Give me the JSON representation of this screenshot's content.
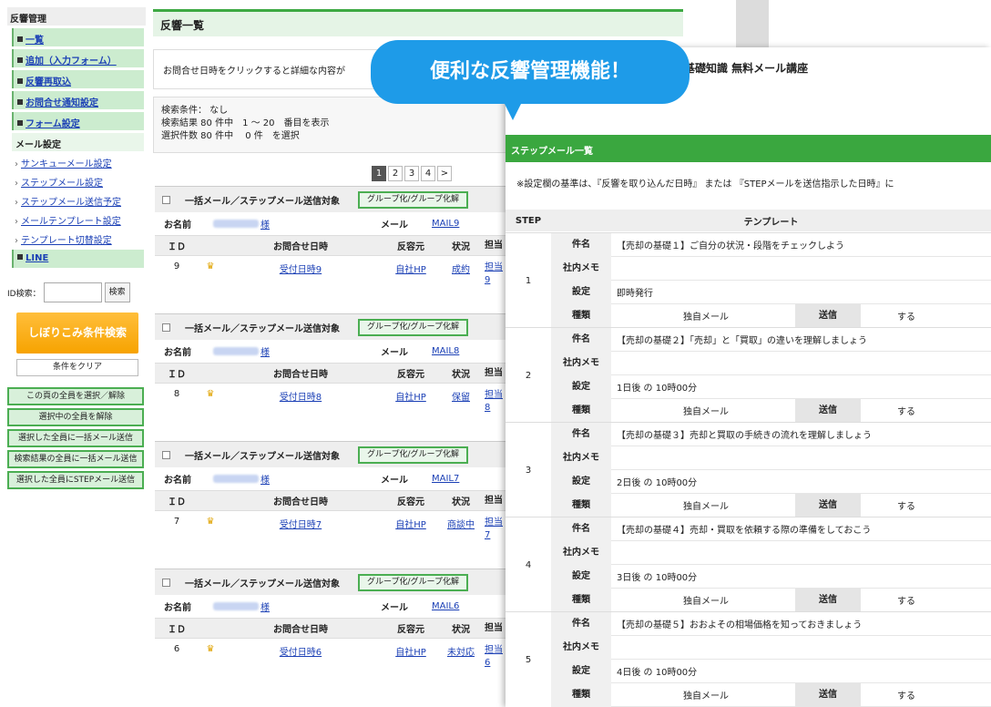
{
  "sidebar": {
    "title": "反響管理",
    "items": [
      {
        "label": "一覧"
      },
      {
        "label": "追加（入力フォーム）"
      },
      {
        "label": "反響再取込"
      },
      {
        "label": "お問合せ通知設定"
      },
      {
        "label": "フォーム設定"
      }
    ],
    "mail_section": "メール設定",
    "mail_links": [
      {
        "label": "サンキューメール設定"
      },
      {
        "label": "ステップメール設定"
      },
      {
        "label": "ステップメール送信予定"
      },
      {
        "label": "メールテンプレート設定"
      },
      {
        "label": "テンプレート切替設定"
      }
    ],
    "line_item": "LINE",
    "id_search_label": "ID検索：",
    "id_search_button": "検索",
    "filter_button": "しぼりこみ条件検索",
    "clear_button": "条件をクリア",
    "bulk_buttons": [
      "この頁の全員を選択／解除",
      "選択中の全員を解除",
      "選択した全員に一括メール送信",
      "検索結果の全員に一括メール送信",
      "選択した全員にSTEPメール送信"
    ]
  },
  "main": {
    "title": "反響一覧",
    "notice": "お問合せ日時をクリックすると詳細な内容が",
    "conditions": [
      "検索条件： なし",
      "検索結果 80 件中　1 ～ 20　番目を表示",
      "選択件数 80 件中　 0 件　を選択"
    ],
    "pages": [
      "1",
      "2",
      "3",
      "4",
      ">"
    ],
    "card_header": "一括メール／ステップメール送信対象",
    "group_button": "グループ化/グループ化解",
    "name_label": "お名前",
    "name_suffix": "様",
    "mail_label": "メール",
    "columns": {
      "id": "ＩＤ",
      "date": "お問合せ日時",
      "source": "反容元",
      "status": "状況",
      "staff": "担当"
    },
    "crown": "♛",
    "records": [
      {
        "mail": "MAIL9",
        "id": "9",
        "date": "受付日時9",
        "source": "自社HP",
        "status": "成約",
        "staff1": "担当",
        "staff2": "9"
      },
      {
        "mail": "MAIL8",
        "id": "8",
        "date": "受付日時8",
        "source": "自社HP",
        "status": "保留",
        "staff1": "担当",
        "staff2": "8"
      },
      {
        "mail": "MAIL7",
        "id": "7",
        "date": "受付日時7",
        "source": "自社HP",
        "status": "商談中",
        "staff1": "担当",
        "staff2": "7"
      },
      {
        "mail": "MAIL6",
        "id": "6",
        "date": "受付日時6",
        "source": "自社HP",
        "status": "未対応",
        "staff1": "担当",
        "staff2": "6"
      }
    ]
  },
  "overlay": {
    "course_title": "売却の基礎知識 無料メール講座",
    "section_title": "ステップメール一覧",
    "note": "※設定欄の基準は、『反響を取り込んだ日時』 または 『STEPメールを送信指示した日時』に",
    "col_step": "STEP",
    "col_template": "テンプレート",
    "labels": {
      "subject": "件名",
      "memo": "社内メモ",
      "setting": "設定",
      "kind": "種類"
    },
    "kind_value": "独自メール",
    "send_label": "送信",
    "send_value": "する",
    "steps": [
      {
        "num": "1",
        "subject": "【売却の基礎１】ご自分の状況・段階をチェックしよう",
        "setting": "即時発行"
      },
      {
        "num": "2",
        "subject": "【売却の基礎２】「売却」と「買取」の違いを理解しましょう",
        "setting": "1日後 の 10時00分"
      },
      {
        "num": "3",
        "subject": "【売却の基礎３】売却と買取の手続きの流れを理解しましょう",
        "setting": "2日後 の 10時00分"
      },
      {
        "num": "4",
        "subject": "【売却の基礎４】売却・買取を依頼する際の準備をしておこう",
        "setting": "3日後 の 10時00分"
      },
      {
        "num": "5",
        "subject": "【売却の基礎５】おおよその相場価格を知っておきましょう",
        "setting": "4日後 の 10時00分"
      }
    ]
  },
  "bubble": "便利な反響管理機能！"
}
